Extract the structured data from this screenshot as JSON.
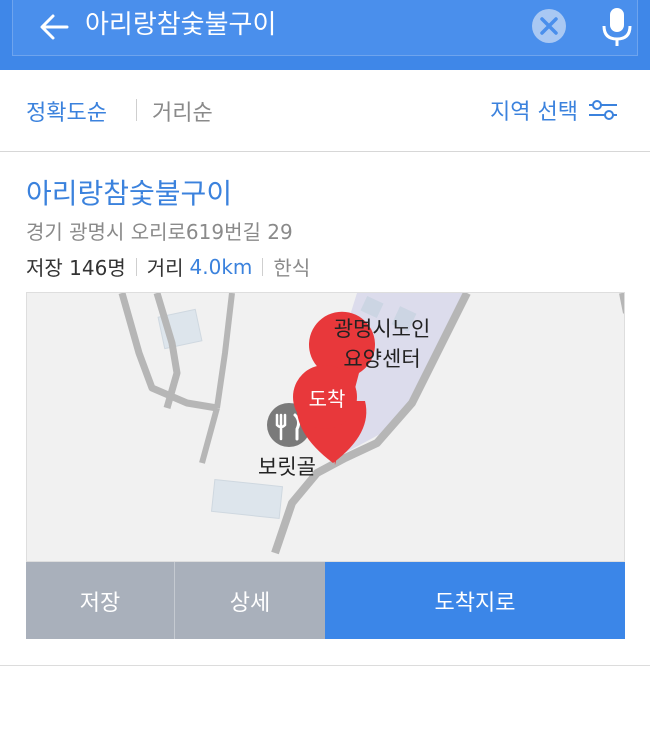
{
  "search": {
    "query": "아리랑참숯불구이",
    "back_icon": "back-arrow-icon",
    "clear_icon": "clear-icon",
    "mic_icon": "microphone-icon"
  },
  "sort": {
    "accuracy_label": "정확도순",
    "distance_label": "거리순",
    "region_label": "지역 선택",
    "filter_icon": "filter-sliders-icon"
  },
  "result": {
    "name": "아리랑참숯불구이",
    "address": "경기 광명시 오리로619번길 29",
    "saves": "저장 146명",
    "distance_label": "거리",
    "distance_value": "4.0km",
    "category": "한식"
  },
  "map": {
    "poi_1": "광명시노인",
    "poi_2": "요양센터",
    "poi_3": "보릿골",
    "pin_label": "도착",
    "restaurant_icon": "restaurant-icon"
  },
  "actions": {
    "save_label": "저장",
    "detail_label": "상세",
    "destination_label": "도착지로"
  },
  "colors": {
    "header": "#3f87e8",
    "accent": "#3b82dd",
    "pin": "#e8383b",
    "button_gray": "#a9b0bb",
    "button_blue": "#3b86e8"
  }
}
